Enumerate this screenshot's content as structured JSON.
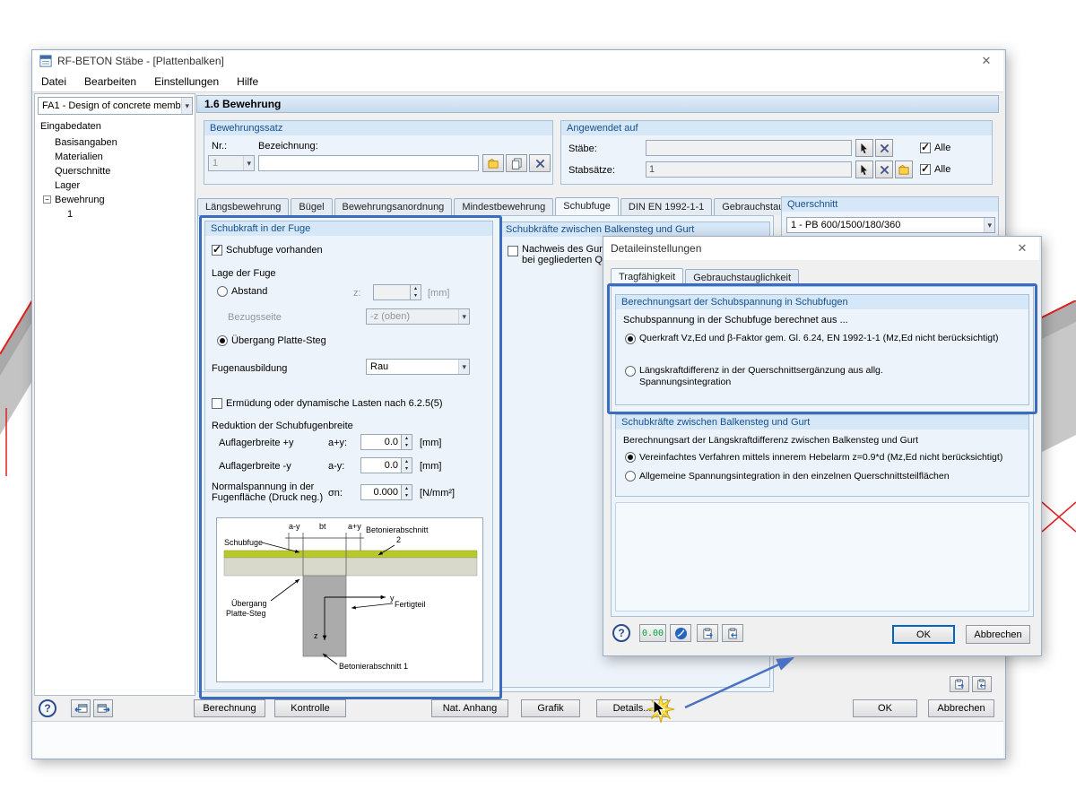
{
  "icons": {
    "help": "?",
    "combo_arrow": "▾",
    "spin_up": "▴",
    "spin_down": "▾",
    "close": "✕",
    "tree_collapse": "−"
  },
  "colors": {
    "highlight_border": "#3a6cc0",
    "annotation_arrow": "#4a72c4",
    "caption_bg": "#d6e7f7",
    "caption_text": "#15508e",
    "slab_green": "#b7c92a"
  },
  "window": {
    "title": "RF-BETON Stäbe - [Plattenbalken]",
    "menu": [
      "Datei",
      "Bearbeiten",
      "Einstellungen",
      "Hilfe"
    ]
  },
  "sidebar": {
    "case_selector": "FA1 - Design of concrete memb",
    "tree": {
      "root": "Eingabedaten",
      "items": [
        "Basisangaben",
        "Materialien",
        "Querschnitte",
        "Lager",
        "Bewehrung"
      ],
      "child": "1"
    }
  },
  "header": {
    "title": "1.6 Bewehrung"
  },
  "bewehrungssatz": {
    "title": "Bewehrungssatz",
    "nr_label": "Nr.:",
    "nr_value": "1",
    "bez_label": "Bezeichnung:",
    "bez_value": ""
  },
  "angewendet": {
    "title": "Angewendet auf",
    "staebe_label": "Stäbe:",
    "staebe_value": "",
    "stabsaetze_label": "Stabsätze:",
    "stabsaetze_value": "1",
    "alle1": "Alle",
    "alle2": "Alle"
  },
  "tabs": {
    "labels": [
      "Längsbewehrung",
      "Bügel",
      "Bewehrungsanordnung",
      "Mindestbewehrung",
      "Schubfuge",
      "DIN EN 1992-1-1",
      "Gebrauchstauglichkeit"
    ],
    "active": "Schubfuge"
  },
  "querschnitt": {
    "title": "Querschnitt",
    "value": "1 - PB 600/1500/180/360"
  },
  "fuge": {
    "title": "Schubkraft in der Fuge",
    "cb_vorhanden": "Schubfuge vorhanden",
    "lage": "Lage der Fuge",
    "abstand": "Abstand",
    "z_label": "z:",
    "z_value": "",
    "z_unit": "[mm]",
    "bezugsseite": "Bezugsseite",
    "bezugsseite_value": "-z (oben)",
    "uebergang": "Übergang Platte-Steg",
    "ausbildung_label": "Fugenausbildung",
    "ausbildung_value": "Rau",
    "cb_ermuedung": "Ermüdung oder dynamische Lasten nach 6.2.5(5)",
    "reduktion": "Reduktion der Schubfugenbreite",
    "auflager_plus": "Auflagerbreite +y",
    "a_plus": "a+y:",
    "a_plus_value": "0.0",
    "a_plus_unit": "[mm]",
    "auflager_minus": "Auflagerbreite -y",
    "a_minus": "a-y:",
    "a_minus_value": "0.0",
    "a_minus_unit": "[mm]",
    "normalspannung1": "Normalspannung in der",
    "normalspannung2": "Fugenfläche (Druck neg.)",
    "sigma": "σn:",
    "sigma_value": "0.000",
    "sigma_unit": "[N/mm²]",
    "diagram": {
      "schubfuge": "Schubfuge",
      "dim_ay": "a-y",
      "dim_bt": "bt",
      "dim_apy": "a+y",
      "beton2a": "Betonierabschnitt",
      "beton2b": "2",
      "uebergang1": "Übergang",
      "uebergang2": "Platte-Steg",
      "fertigteil": "Fertigteil",
      "beton1": "Betonierabschnitt 1",
      "axis_y": "y",
      "axis_z": "z"
    }
  },
  "gurt": {
    "title": "Schubkräfte zwischen Balkensteg und Gurt",
    "cb_line1": "Nachweis des Gurtan",
    "cb_line2": "bei gegliederten Que"
  },
  "dialog": {
    "title": "Detaileinstellungen",
    "tab_trag": "Tragfähigkeit",
    "tab_gebrauch": "Gebrauchstauglichkeit",
    "g1_title": "Berechnungsart der Schubspannung in Schubfugen",
    "g1_intro": "Schubspannung in der Schubfuge berechnet aus ...",
    "g1_r1": "Querkraft Vz,Ed und β-Faktor gem. Gl. 6.24, EN 1992-1-1 (Mz,Ed nicht berücksichtigt)",
    "g1_r2": "Längskraftdifferenz in der Querschnittsergänzung aus allg. Spannungsintegration",
    "g2_title": "Schubkräfte zwischen Balkensteg und Gurt",
    "g2_intro": "Berechnungsart der Längskraftdifferenz zwischen Balkensteg und Gurt",
    "g2_r1": "Vereinfachtes Verfahren mittels innerem Hebelarm z=0.9*d (Mz,Ed nicht berücksichtigt)",
    "g2_r2": "Allgemeine Spannungsintegration in den einzelnen Querschnittsteilflächen",
    "display_value": "0.00",
    "ok": "OK",
    "cancel": "Abbrechen"
  },
  "footer": {
    "berechnung": "Berechnung",
    "kontrolle": "Kontrolle",
    "nat_anhang": "Nat. Anhang",
    "grafik": "Grafik",
    "details": "Details...",
    "ok": "OK",
    "cancel": "Abbrechen"
  }
}
